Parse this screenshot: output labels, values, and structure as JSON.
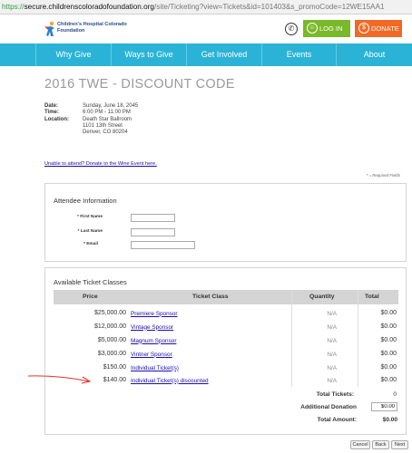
{
  "browser": {
    "url_protocol": "https://",
    "url_host": "secure.childrenscoloradofoundation.org",
    "url_path": "/site/Ticketing?view=Tickets&id=101403&s_promoCode=12WE15AA1"
  },
  "header": {
    "logo_text": "Children's Hospital Colorado Foundation",
    "login_label": "LOG IN",
    "donate_label": "DONATE",
    "colors": {
      "login": "#7ab929",
      "donate": "#f06a25",
      "nav": "#2ab3d6"
    }
  },
  "nav": {
    "items": [
      "Why Give",
      "Ways to Give",
      "Get Involved",
      "Events",
      "About"
    ]
  },
  "page": {
    "title": "2016 TWE - DISCOUNT CODE",
    "date_label": "Date:",
    "date_value": "Sunday, June 18, 2045",
    "time_label": "Time:",
    "time_value": "6:00 PM - 11:00 PM",
    "location_label": "Location:",
    "location_lines": [
      "Death Star Ballroom",
      "1101 13th Street",
      "Denver, CO 80204"
    ],
    "donate_link": "Unable to attend? Donate to the Wine Event here.",
    "required_note": "* = Required Fields"
  },
  "attendee": {
    "title": "Attendee Information",
    "first_name_label": "* First Name",
    "last_name_label": "* Last Name",
    "email_label": "* Email",
    "first_name_value": "",
    "last_name_value": "",
    "email_value": ""
  },
  "tickets": {
    "title": "Available Ticket Classes",
    "headers": {
      "price": "Price",
      "class": "Ticket Class",
      "quantity": "Quantity",
      "total": "Total"
    },
    "rows": [
      {
        "price": "$25,000.00",
        "class": "Premiere Sponsor",
        "qty": "N/A",
        "total": "$0.00"
      },
      {
        "price": "$12,000.00",
        "class": "Vintage Sponsor",
        "qty": "N/A",
        "total": "$0.00"
      },
      {
        "price": "$5,000.00",
        "class": "Magnum Sponsor",
        "qty": "N/A",
        "total": "$0.00"
      },
      {
        "price": "$3,000.00",
        "class": "Vintner Sponsor",
        "qty": "N/A",
        "total": "$0.00"
      },
      {
        "price": "$150.00",
        "class": "Individual Ticket(s)",
        "qty": "N/A",
        "total": "$0.00"
      },
      {
        "price": "$140.00",
        "class": "Individual Ticket(s) discounted",
        "qty": "N/A",
        "total": "$0.00"
      }
    ],
    "total_tickets_label": "Total Tickets:",
    "total_tickets_value": "0",
    "additional_donation_label": "Additional Donation",
    "additional_donation_value": "$0.00",
    "total_amount_label": "Total Amount:",
    "total_amount_value": "$0.00"
  },
  "footer": {
    "cancel_label": "Cancel",
    "back_label": "Back",
    "next_label": "Next"
  }
}
